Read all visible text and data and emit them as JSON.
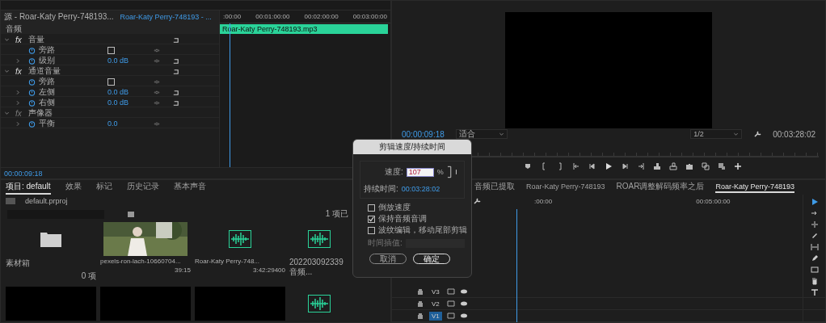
{
  "effect_controls": {
    "source_tab": "源 - Roar-Katy Perry-748193...",
    "clip_tab": "Roar-Katy Perry-748193 - ...",
    "section": "音频",
    "rows": [
      {
        "kind": "group",
        "fx": "fx",
        "label": "音量",
        "fx_enabled": true,
        "reset": true
      },
      {
        "kind": "checkbox",
        "label": "旁路",
        "checked": false
      },
      {
        "kind": "value",
        "label": "级别",
        "value": "0.0 dB",
        "reset": true
      },
      {
        "kind": "group",
        "fx": "fx",
        "label": "通道音量",
        "fx_enabled": true,
        "reset": true
      },
      {
        "kind": "checkbox",
        "label": "旁路",
        "checked": false
      },
      {
        "kind": "value",
        "label": "左侧",
        "value": "0.0 dB",
        "reset": true
      },
      {
        "kind": "value",
        "label": "右侧",
        "value": "0.0 dB",
        "reset": true
      },
      {
        "kind": "group",
        "fx": "fx",
        "label": "声像器",
        "fx_enabled": false,
        "reset": false
      },
      {
        "kind": "value",
        "label": "平衡",
        "value": "0.0",
        "reset": false
      }
    ],
    "ruler": [
      ":00:00",
      "00:01:00:00",
      "00:02:00:00",
      "00:03:00:00"
    ],
    "clip": "Roar-Katy Perry-748193.mp3",
    "timecode": "00:00:09:18"
  },
  "program_monitor": {
    "timecode": "00:00:09:18",
    "zoom": "适合",
    "resolution": "1/2",
    "duration": "00:03:28:02"
  },
  "project": {
    "tabs": [
      {
        "label": "项目: default",
        "selected": true
      },
      {
        "label": "效果",
        "selected": false
      },
      {
        "label": "标记",
        "selected": false
      },
      {
        "label": "历史记录",
        "selected": false
      },
      {
        "label": "基本声音",
        "selected": false
      }
    ],
    "file": "default.prproj",
    "count": "1 项已",
    "items": [
      {
        "kind": "bin",
        "name": "素材箱",
        "meta": "0 项"
      },
      {
        "kind": "video",
        "name": "pexels-ron-lach-10660704...",
        "meta": "39:15"
      },
      {
        "kind": "audio",
        "name": "Roar-Katy Perry-748...",
        "meta": "3:42:29400"
      },
      {
        "kind": "audio",
        "name": "202203092339 音频..."
      },
      {
        "kind": "black"
      },
      {
        "kind": "black"
      },
      {
        "kind": "black"
      },
      {
        "kind": "audio"
      }
    ]
  },
  "timeline": {
    "tabs": [
      {
        "label": "音频已提取",
        "selected": false
      },
      {
        "label": "Roar-Katy Perry-748193",
        "selected": false
      },
      {
        "label": "ROAR调整解码频率之后",
        "selected": false
      },
      {
        "label": "Roar-Katy Perry-748193",
        "selected": true
      }
    ],
    "ruler": [
      ":00:00",
      "00:05:00:00"
    ],
    "tracks": [
      {
        "label": "V3",
        "selected": false
      },
      {
        "label": "V2",
        "selected": false
      },
      {
        "label": "V1",
        "selected": true
      }
    ]
  },
  "dialog": {
    "title": "剪辑速度/持续时间",
    "speed_label": "速度:",
    "speed": "107",
    "unit": "%",
    "duration_label": "持续时间:",
    "duration": "00:03:28:02",
    "options": [
      {
        "label": "倒放速度",
        "checked": false
      },
      {
        "label": "保持音频音调",
        "checked": true
      },
      {
        "label": "波纹编辑，移动尾部剪辑",
        "checked": false
      }
    ],
    "interp_label": "时间插值:",
    "cancel": "取消",
    "ok": "确定"
  }
}
